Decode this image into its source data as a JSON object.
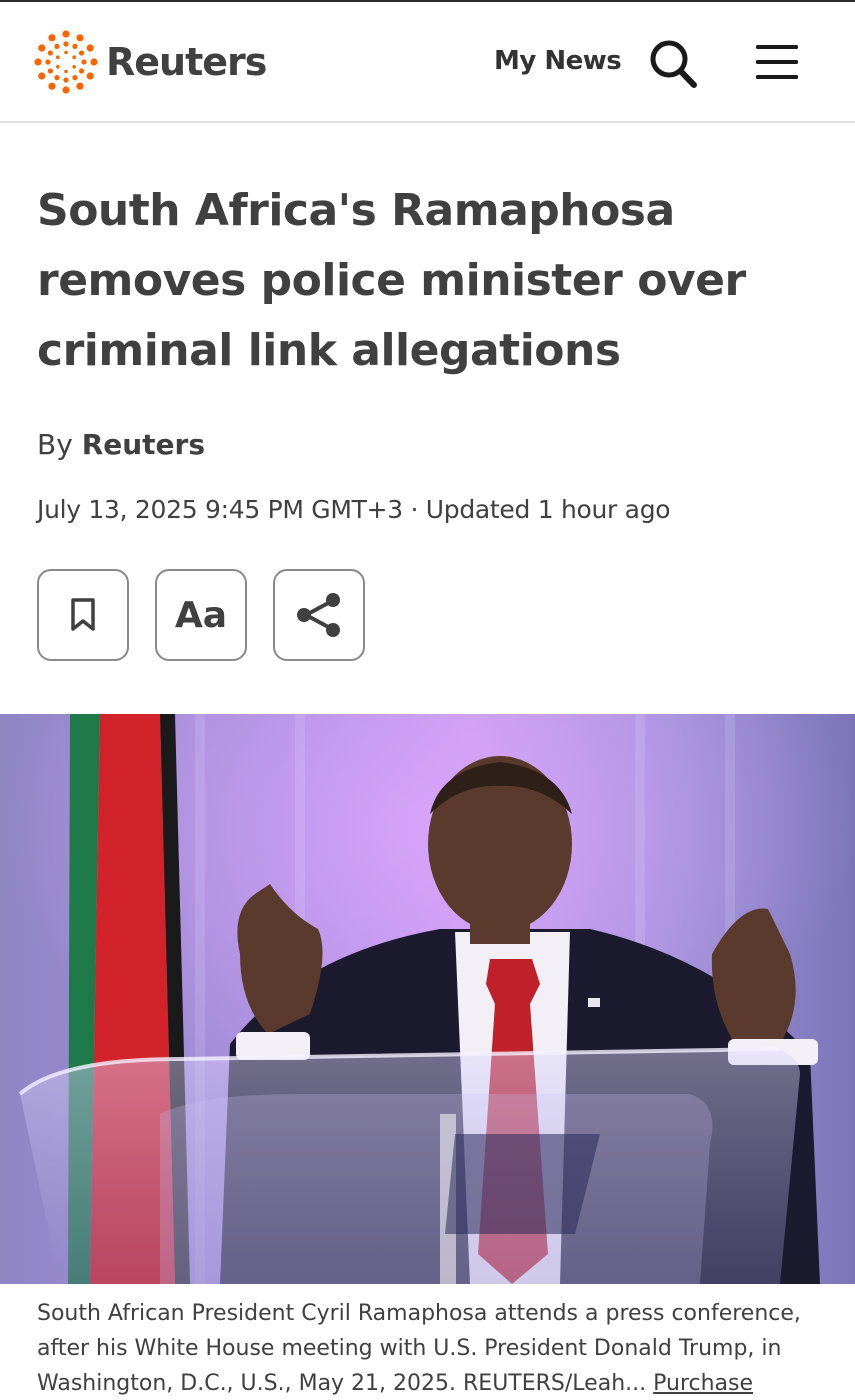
{
  "header": {
    "brand": "Reuters",
    "my_news_label": "My News",
    "search_icon": "search-icon",
    "menu_icon": "hamburger-menu-icon"
  },
  "article": {
    "headline": "South Africa's Ramaphosa removes police minister over criminal link allegations",
    "byline_prefix": "By",
    "byline_author": "Reuters",
    "dateline": "July 13, 2025 9:45 PM GMT+3 · Updated 1 hour ago",
    "tools": {
      "bookmark_icon": "bookmark-icon",
      "font_size_label": "Aa",
      "share_icon": "share-icon"
    },
    "image": {
      "caption": "South African President Cyril Ramaphosa attends a press conference, after his White House meeting with U.S. President Donald Trump, in Washington, D.C., U.S., May 21, 2025. REUTERS/Leah...",
      "purchase_link": "Purchase"
    }
  },
  "colors": {
    "brand_orange": "#fa6400",
    "text_dark": "#404040",
    "divider": "#e0e0e0"
  }
}
